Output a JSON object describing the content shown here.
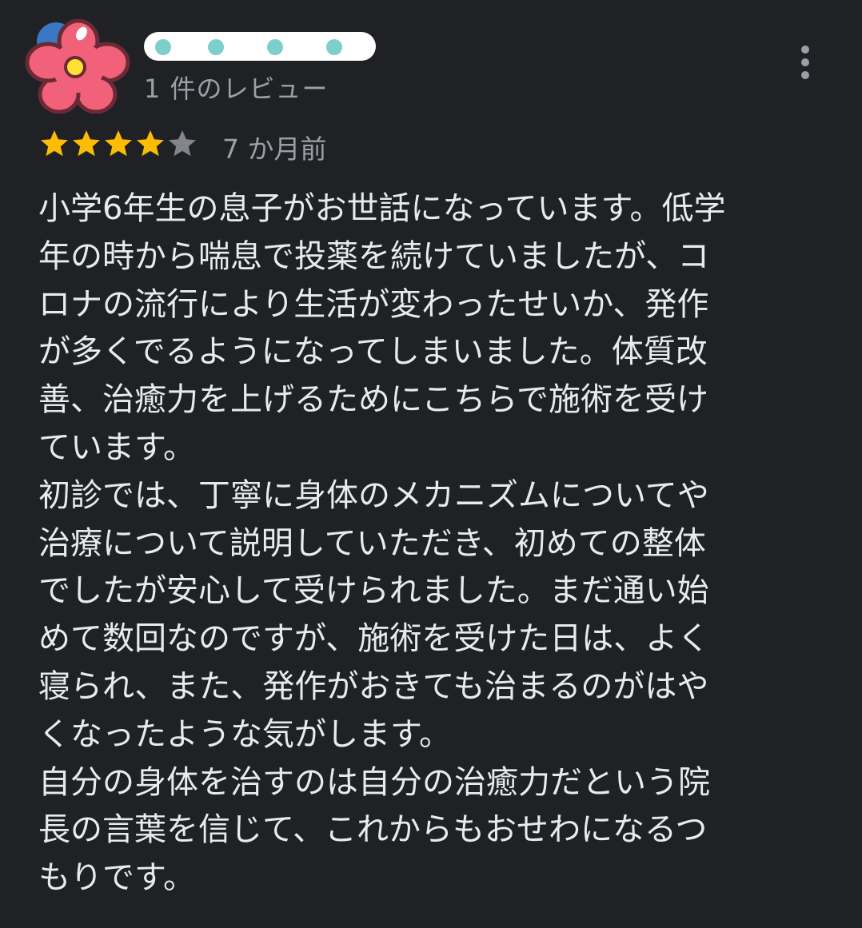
{
  "reviewer": {
    "review_count": "1 件のレビュー"
  },
  "review": {
    "rating": 4,
    "max_rating": 5,
    "date": "7 か月前",
    "lines": [
      "小学6年生の息子がお世話になっています。低学",
      "年の時から喘息で投薬を続けていましたが、コ",
      "ロナの流行により生活が変わったせいか、発作",
      "が多くでるようになってしまいました。体質改",
      "善、治癒力を上げるためにこちらで施術を受け",
      "ています。",
      "初診では、丁寧に身体のメカニズムについてや",
      "治療について説明していただき、初めての整体",
      "でしたが安心して受けられました。まだ通い始",
      "めて数回なのですが、施術を受けた日は、よく",
      "寝られ、また、発作がおきても治まるのがはや",
      "くなったような気がします。",
      "自分の身体を治すのは自分の治癒力だという院",
      "長の言葉を信じて、これからもおせわになるつ",
      "もりです。"
    ]
  },
  "colors": {
    "background": "#202124",
    "text_primary": "#e8eaed",
    "text_secondary": "#9aa0a6",
    "star_filled": "#fbbc04",
    "star_empty": "#80868b",
    "avatar_petal": "#f2617a",
    "avatar_center": "#ffe033",
    "name_mask": "#ffffff",
    "name_dots": "#7ccfcb"
  },
  "icons": {
    "avatar": "flower-avatar-icon",
    "more": "more-vert-icon",
    "star": "star-icon"
  }
}
